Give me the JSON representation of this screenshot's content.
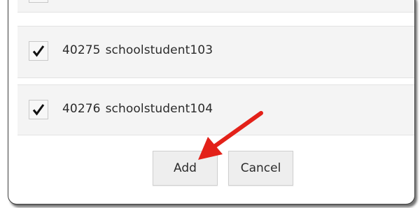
{
  "list": {
    "rows": [
      {
        "id": "",
        "name": "",
        "checked": false
      },
      {
        "id": "40275",
        "name": "schoolstudent103",
        "checked": true
      },
      {
        "id": "40276",
        "name": "schoolstudent104",
        "checked": true
      }
    ]
  },
  "actions": {
    "add_label": "Add",
    "cancel_label": "Cancel"
  },
  "colors": {
    "arrow": "#e32119",
    "row_background": "#f4f4f4",
    "button_background": "#eeeeee"
  },
  "icons": {
    "check": "check-icon",
    "annotation": "pointer-arrow-icon"
  }
}
